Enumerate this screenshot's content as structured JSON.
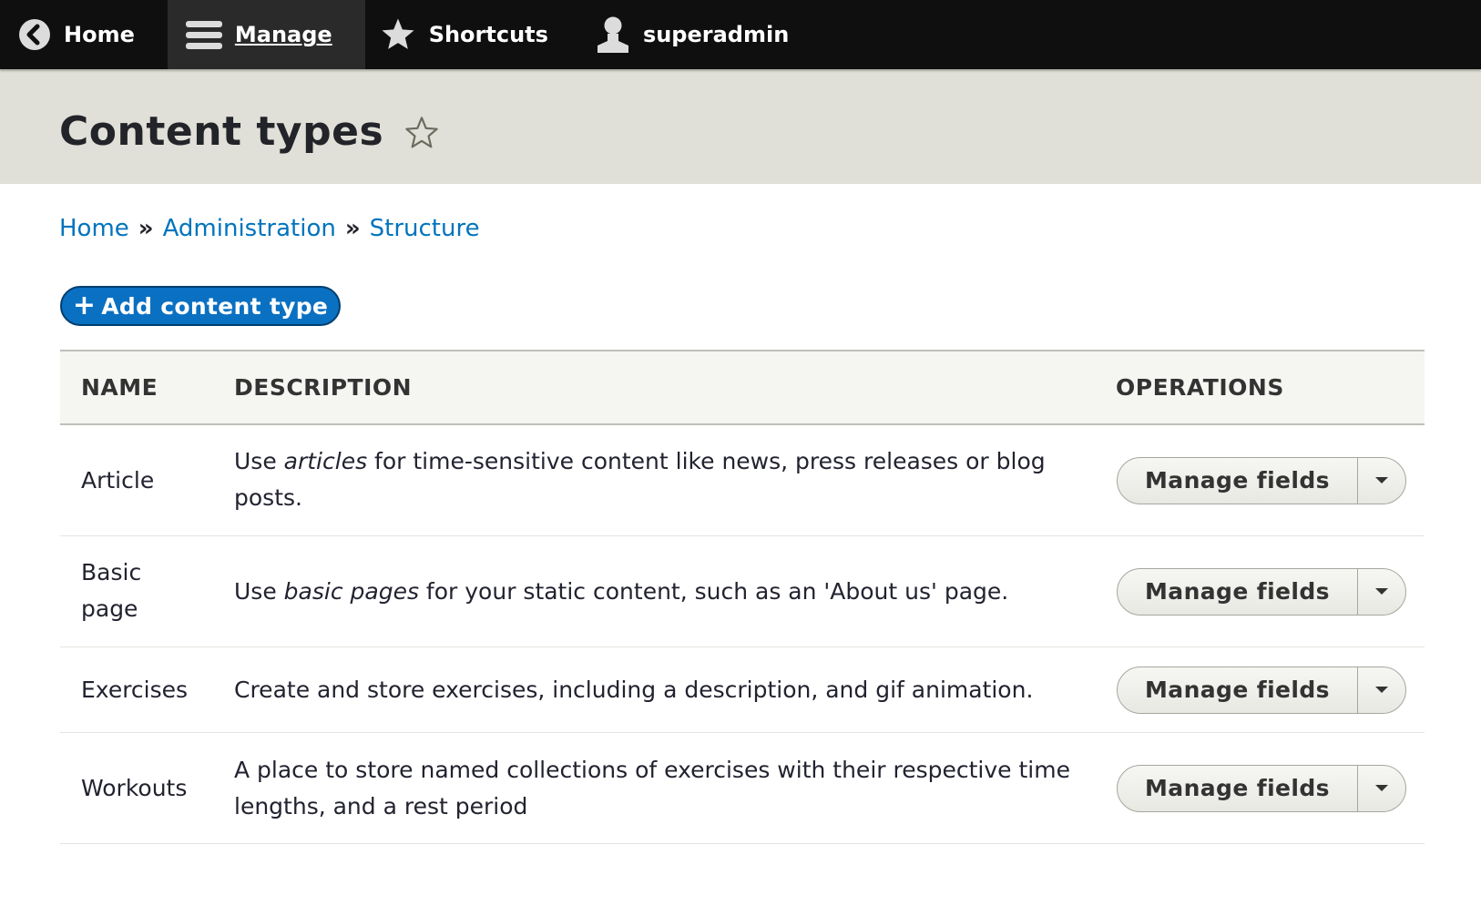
{
  "toolbar": {
    "home_label": "Home",
    "manage_label": "Manage",
    "shortcuts_label": "Shortcuts",
    "user_label": "superadmin"
  },
  "page": {
    "title": "Content types"
  },
  "breadcrumb": {
    "items": [
      "Home",
      "Administration",
      "Structure"
    ],
    "separator": "»"
  },
  "actions": {
    "add_plus": "+",
    "add_label": "Add content type"
  },
  "table": {
    "headers": {
      "name": "NAME",
      "description": "DESCRIPTION",
      "operations": "OPERATIONS"
    },
    "rows": [
      {
        "name": "Article",
        "desc_before": "Use ",
        "desc_em": "articles",
        "desc_after": " for time-sensitive content like news, press releases or blog posts.",
        "operation": "Manage fields"
      },
      {
        "name": "Basic page",
        "desc_before": "Use ",
        "desc_em": "basic pages",
        "desc_after": " for your static content, such as an 'About us' page.",
        "operation": "Manage fields"
      },
      {
        "name": "Exercises",
        "desc_before": "Create and store exercises, including a description, and gif animation.",
        "desc_em": "",
        "desc_after": "",
        "operation": "Manage fields"
      },
      {
        "name": "Workouts",
        "desc_before": "A place to store named collections of exercises with their respective time lengths, and a rest period",
        "desc_em": "",
        "desc_after": "",
        "operation": "Manage fields"
      }
    ]
  },
  "colors": {
    "toolbar_bg": "#0f0f0f",
    "header_bg": "#e0e0d8",
    "link": "#0074bd",
    "primary_button": "#0a70c2"
  }
}
